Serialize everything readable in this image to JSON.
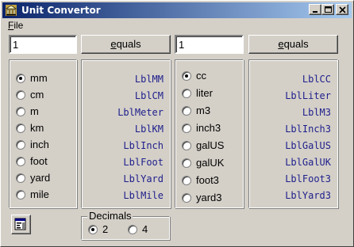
{
  "window": {
    "title": "Unit Convertor",
    "menu_file": "File",
    "menu_file_accel": "F",
    "menu_file_rest": "ile"
  },
  "length": {
    "input_value": "1",
    "equals_accel": "e",
    "equals_rest": "quals",
    "units": [
      "mm",
      "cm",
      "m",
      "km",
      "inch",
      "foot",
      "yard",
      "mile"
    ],
    "selected_unit": "mm",
    "labels": [
      "LblMM",
      "LblCM",
      "LblMeter",
      "LblKM",
      "LblInch",
      "LblFoot",
      "LblYard",
      "LblMile"
    ]
  },
  "volume": {
    "input_value": "1",
    "equals_accel": "e",
    "equals_rest": "quals",
    "units": [
      "cc",
      "liter",
      "m3",
      "inch3",
      "galUS",
      "galUK",
      "foot3",
      "yard3"
    ],
    "selected_unit": "cc",
    "labels": [
      "LblCC",
      "LblLiter",
      "LblM3",
      "LblInch3",
      "LblGalUS",
      "LblGalUK",
      "LblFoot3",
      "LblYard3"
    ]
  },
  "decimals": {
    "title": "Decimals",
    "options": [
      "2",
      "4"
    ],
    "selected": "2"
  },
  "colors": {
    "titlebar_start": "#0a246a",
    "titlebar_end": "#a6caf0",
    "label_text": "#1e1e8c",
    "face": "#d4d0c8"
  }
}
